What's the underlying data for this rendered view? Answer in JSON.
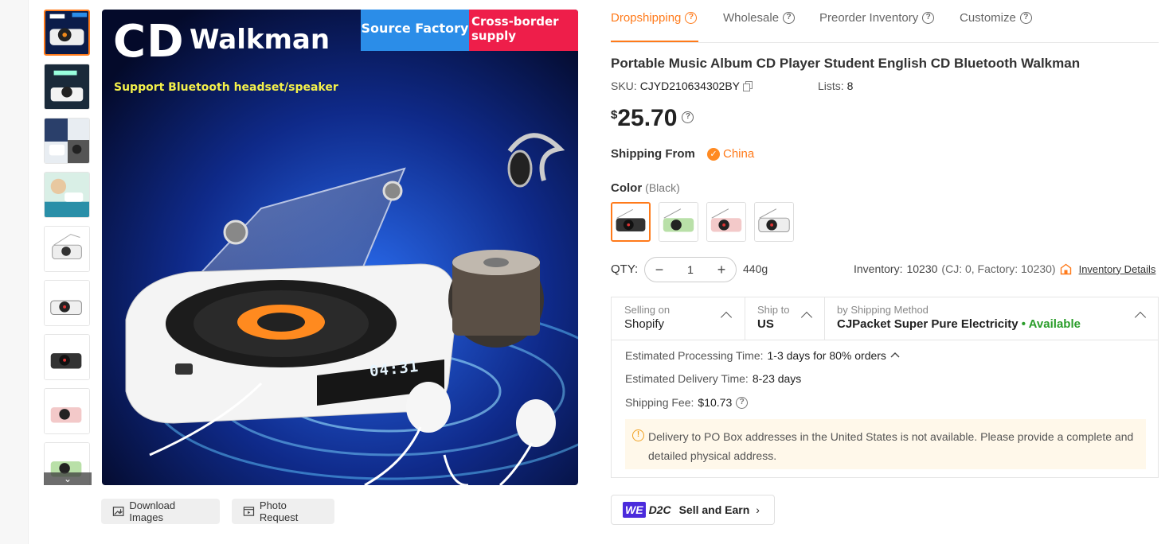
{
  "gallery": {
    "main_image": {
      "heading_cd": "CD",
      "heading_walkman": "Walkman",
      "badge_source": "Source Factory",
      "badge_cross": "Cross-border supply",
      "subtitle": "Support Bluetooth headset/speaker",
      "lcd_time": "04:31"
    },
    "thumbnails_count": 9,
    "scroll_down_icon": "chevron-down-icon",
    "download_label": "Download Images",
    "photo_request_label": "Photo Request"
  },
  "tabs": [
    {
      "label": "Dropshipping",
      "active": true
    },
    {
      "label": "Wholesale",
      "active": false
    },
    {
      "label": "Preorder Inventory",
      "active": false
    },
    {
      "label": "Customize",
      "active": false
    }
  ],
  "product": {
    "title": "Portable Music Album CD Player Student English CD Bluetooth Walkman",
    "sku_label": "SKU:",
    "sku_value": "CJYD210634302BY",
    "lists_label": "Lists:",
    "lists_value": "8",
    "currency": "$",
    "price": "25.70",
    "shipping_from_label": "Shipping From",
    "shipping_from_value": "China",
    "color_label": "Color",
    "color_selected": "(Black)",
    "qty_label": "QTY:",
    "qty_value": "1",
    "weight": "440g",
    "inventory_label": "Inventory:",
    "inventory_value": "10230",
    "inventory_breakdown": "(CJ: 0, Factory: 10230)",
    "inventory_link": "Inventory Details"
  },
  "shipping": {
    "selling_on_label": "Selling on",
    "selling_on_value": "Shopify",
    "ship_to_label": "Ship to",
    "ship_to_value": "US",
    "method_label": "by Shipping Method",
    "method_value": "CJPacket Super Pure Electricity",
    "method_status": "• Available",
    "processing_label": "Estimated Processing Time:",
    "processing_value": "1-3 days for 80% orders",
    "delivery_label": "Estimated Delivery Time:",
    "delivery_value": "8-23 days",
    "fee_label": "Shipping Fee:",
    "fee_value": "$10.73",
    "warning": "Delivery to PO Box addresses in the United States is not available. Please provide a complete and detailed physical address."
  },
  "promo": {
    "we": "WE",
    "d2c": "D2C",
    "label": "Sell and Earn",
    "chevron": "›"
  },
  "colors": {
    "accent": "#ff7a1a",
    "available": "#2a9d2a",
    "warning_bg": "#fff8ea"
  }
}
